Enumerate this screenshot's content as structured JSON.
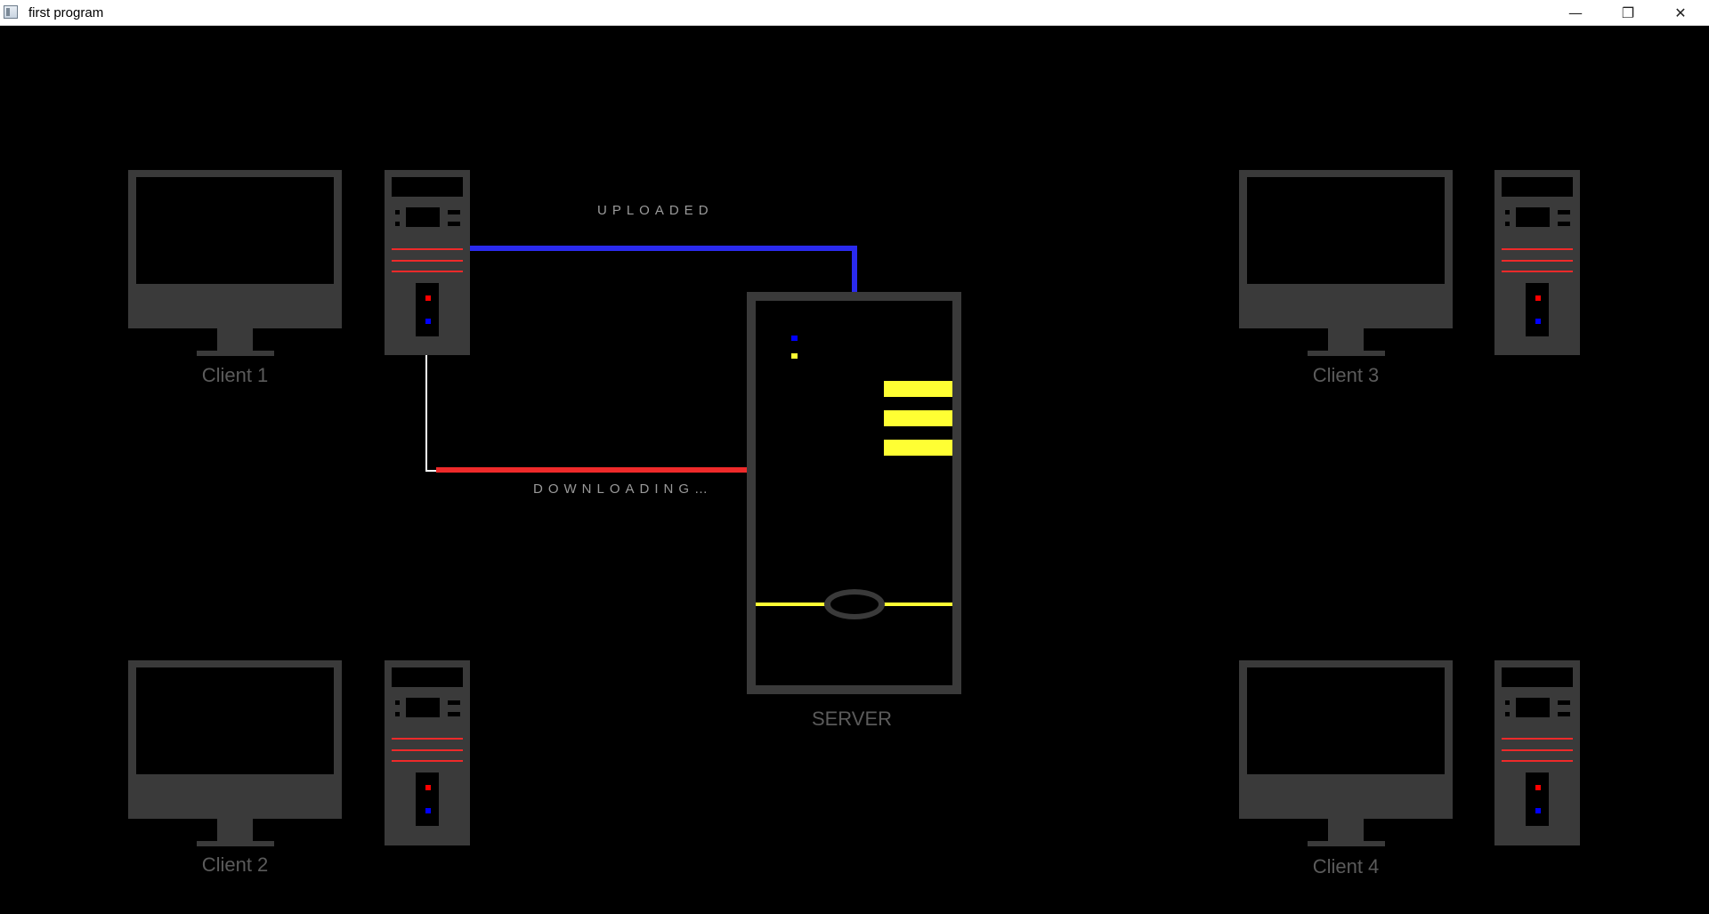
{
  "window": {
    "title": "first program",
    "icon": "app-window-icon",
    "controls": {
      "minimize": "—",
      "maximize": "❐",
      "close": "✕"
    }
  },
  "scene": {
    "status_uploaded": "UPLOADED",
    "status_downloading": "DOWNLOADING…",
    "server_label": "SERVER",
    "clients": [
      {
        "label": "Client 1"
      },
      {
        "label": "Client 2"
      },
      {
        "label": "Client 3"
      },
      {
        "label": "Client 4"
      }
    ],
    "colors": {
      "background": "#000000",
      "device_gray": "#3a3a3a",
      "upload_line": "#2a2aee",
      "download_line": "#ee2a2a",
      "connector": "#ffffff",
      "server_accent": "#ffff33",
      "led_red": "#ff0000",
      "led_blue": "#0000ff"
    }
  }
}
